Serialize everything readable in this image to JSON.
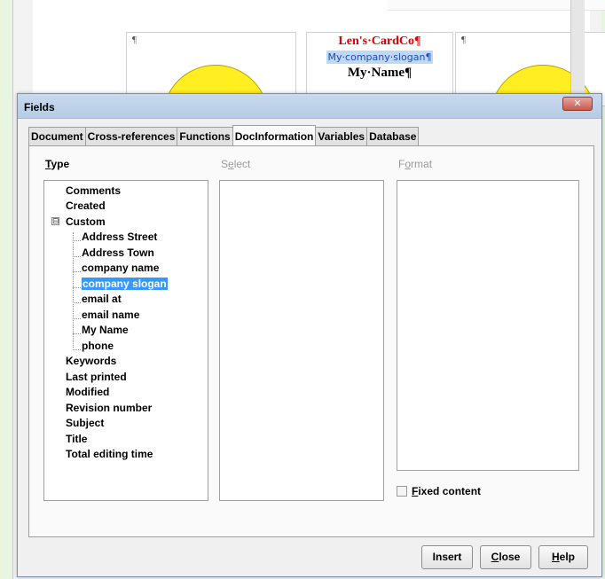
{
  "document": {
    "pilcrow": "¶",
    "card_company": "Len's·CardCo¶",
    "card_slogan": "My·company·slogan¶",
    "card_name": "My·Name¶"
  },
  "dialog": {
    "title": "Fields",
    "close_glyph": "✕",
    "tabs": [
      {
        "label": "Document"
      },
      {
        "label": "Cross-references"
      },
      {
        "label": "Functions"
      },
      {
        "label": "DocInformation",
        "active": true
      },
      {
        "label": "Variables"
      },
      {
        "label": "Database"
      }
    ],
    "type_label_underlined": "T",
    "type_label_rest": "ype",
    "select_label_first": "S",
    "select_label_underlined": "e",
    "select_label_rest": "lect",
    "format_label_first": "F",
    "format_label_underlined": "o",
    "format_label_rest": "rmat",
    "type_items": [
      {
        "label": "Comments"
      },
      {
        "label": "Created"
      },
      {
        "label": "Custom",
        "expanded": true
      },
      {
        "label": "Address Street",
        "child": true
      },
      {
        "label": "Address Town",
        "child": true
      },
      {
        "label": "company name",
        "child": true
      },
      {
        "label": "company slogan",
        "child": true,
        "selected": true
      },
      {
        "label": "email at",
        "child": true
      },
      {
        "label": "email name",
        "child": true
      },
      {
        "label": "My Name",
        "child": true
      },
      {
        "label": "phone",
        "child": true
      },
      {
        "label": "Keywords"
      },
      {
        "label": "Last printed"
      },
      {
        "label": "Modified"
      },
      {
        "label": "Revision number"
      },
      {
        "label": "Subject"
      },
      {
        "label": "Title"
      },
      {
        "label": "Total editing time"
      }
    ],
    "expander_glyph": "⊟",
    "fixed_content_underlined": "F",
    "fixed_content_rest": "ixed content",
    "fixed_content_checked": false,
    "buttons": {
      "insert": "Insert",
      "close_underlined": "C",
      "close_rest": "lose",
      "help_underlined": "H",
      "help_rest": "elp"
    }
  }
}
